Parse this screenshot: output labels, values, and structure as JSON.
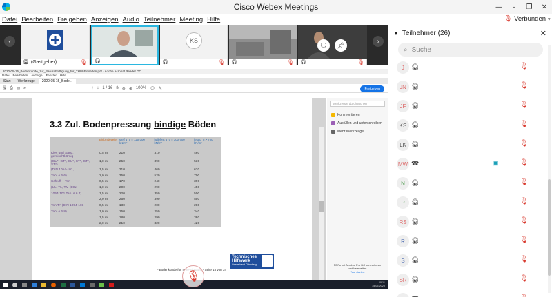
{
  "window": {
    "title": "Cisco Webex Meetings",
    "controls": [
      "–",
      "❐",
      "✕"
    ],
    "collapse": "—"
  },
  "menu": [
    "Datei",
    "Bearbeiten",
    "Freigeben",
    "Anzeigen",
    "Audio",
    "Teilnehmer",
    "Meeting",
    "Hilfe"
  ],
  "status": {
    "connected": "Verbunden"
  },
  "strip": {
    "prev": "‹",
    "next": "›",
    "host_label": "(Gastgeber)",
    "ks_initials": "KS"
  },
  "acrobat": {
    "title": "2020-05-15_Bodenkunde_zur_Baruschnittlgung_fur_THW-Einsatten.pdf - Adobe Acrobat Reader DC",
    "menu": [
      "Datei",
      "Bearbeiten",
      "Anzeige",
      "Fenster",
      "Hilfe"
    ],
    "tabs": [
      "Start",
      "Werkzeuge",
      "2020-05-15_Bode..."
    ],
    "page_info": "1 / 16",
    "zoom": "100%",
    "share_label": "Freigeben",
    "tools_search": "Werkzeuge durchsuchen",
    "tools": [
      {
        "label": "Kommentieren",
        "color": "#f5b800"
      },
      {
        "label": "Ausfüllen und unterschreiben",
        "color": "#9b5fb5"
      },
      {
        "label": "Mehr Werkzeuge",
        "color": "#666666"
      }
    ],
    "promo": "PDFs mit Acrobat Pro DC konvertieren und bearbeiten",
    "promo_link": "Test starten"
  },
  "slide": {
    "heading_pre": "3.3    Zul. Bodenpressung ",
    "heading_u": "bindige",
    "heading_post": " Böden",
    "table": {
      "headers": [
        "",
        "Einbindetiefe",
        "steif\nq_u = 120-300 kN/m²",
        "halbfest\nq_u = 300-700 kN/m²",
        "fest\nq_u > 700 kN/m²"
      ],
      "rows": [
        [
          "Kies und Sand, gemischtkörnig",
          "0,5 m",
          "210",
          "310",
          "460"
        ],
        [
          "(GU*, GT*, SU*, ST*, GT*, ST*)",
          "1,0 m",
          "250",
          "390",
          "530"
        ],
        [
          "(DIN 1054-101,",
          "1,5 m",
          "310",
          "460",
          "620"
        ],
        [
          "Tab. A 6.6)",
          "2,0 m",
          "350",
          "520",
          "700"
        ],
        [
          "Schluff + Ton",
          "0,5 m",
          "170",
          "240",
          "390"
        ],
        [
          "(UL, TL, TM (DIN",
          "1,0 m",
          "200",
          "290",
          "450"
        ],
        [
          "1054-101 Tab. A 6.7)",
          "1,5 m",
          "220",
          "350",
          "500"
        ],
        [
          "",
          "2,0 m",
          "250",
          "390",
          "550"
        ],
        [
          "Ton TA (DIN 1054-101",
          "0,5 m",
          "130",
          "200",
          "280"
        ],
        [
          "Tab. A 6.8)",
          "1,0 m",
          "150",
          "250",
          "340"
        ],
        [
          "",
          "1,5 m",
          "180",
          "290",
          "380"
        ],
        [
          "",
          "2,0 m",
          "210",
          "320",
          "420"
        ]
      ]
    },
    "footer": "- Bodenkunde für THW-Einsätze - Seite 15 von 34",
    "logo_line1": "Technisches",
    "logo_line2": "Hilfswerk",
    "logo_sub": "Ortsverband Ortenberg"
  },
  "taskbar": {
    "time": "20:11",
    "date": "15.05.2020"
  },
  "panel": {
    "title": "Teilnehmer (26)",
    "search_placeholder": "Suche",
    "participants": [
      {
        "initials": "J",
        "device": "headset",
        "camera": false,
        "color": "red"
      },
      {
        "initials": "JN",
        "device": "headset",
        "camera": false,
        "color": "red"
      },
      {
        "initials": "JF",
        "device": "headset",
        "camera": false,
        "color": "red"
      },
      {
        "initials": "KS",
        "device": "headset",
        "camera": false,
        "color": "gray"
      },
      {
        "initials": "LK",
        "device": "headset",
        "camera": false,
        "color": "gray"
      },
      {
        "initials": "MW",
        "device": "phone",
        "camera": true,
        "color": "red"
      },
      {
        "initials": "N",
        "device": "headset",
        "camera": false,
        "color": "green"
      },
      {
        "initials": "P",
        "device": "headset",
        "camera": false,
        "color": "green"
      },
      {
        "initials": "RS",
        "device": "headset",
        "camera": false,
        "color": "red"
      },
      {
        "initials": "R",
        "device": "headset",
        "camera": false,
        "color": "blue"
      },
      {
        "initials": "S",
        "device": "headset",
        "camera": false,
        "color": "blue"
      },
      {
        "initials": "SR",
        "device": "headset",
        "camera": false,
        "color": "red"
      },
      {
        "initials": "Y",
        "device": "phone",
        "camera": false,
        "color": "gray"
      }
    ]
  }
}
